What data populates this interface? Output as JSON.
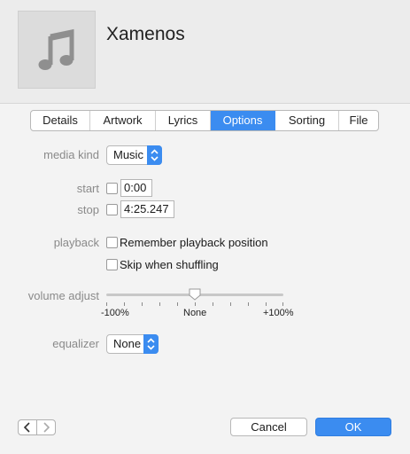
{
  "track": {
    "title": "Xamenos",
    "artwork_icon": "music-note-icon"
  },
  "tabs": [
    {
      "label": "Details",
      "active": false
    },
    {
      "label": "Artwork",
      "active": false
    },
    {
      "label": "Lyrics",
      "active": false
    },
    {
      "label": "Options",
      "active": true
    },
    {
      "label": "Sorting",
      "active": false
    },
    {
      "label": "File",
      "active": false
    }
  ],
  "options": {
    "media_kind_label": "media kind",
    "media_kind_value": "Music",
    "start_label": "start",
    "start_value": "0:00",
    "start_checked": false,
    "stop_label": "stop",
    "stop_value": "4:25.247",
    "stop_checked": false,
    "playback_label": "playback",
    "remember_label": "Remember playback position",
    "remember_checked": false,
    "skip_label": "Skip when shuffling",
    "skip_checked": false,
    "volume_label": "volume adjust",
    "volume_min_label": "-100%",
    "volume_mid_label": "None",
    "volume_max_label": "+100%",
    "volume_value": 0,
    "equalizer_label": "equalizer",
    "equalizer_value": "None"
  },
  "footer": {
    "prev_icon": "chevron-left-icon",
    "next_icon": "chevron-right-icon",
    "cancel_label": "Cancel",
    "ok_label": "OK"
  },
  "colors": {
    "accent": "#3b8cf0",
    "label_gray": "#8a8a8a"
  }
}
